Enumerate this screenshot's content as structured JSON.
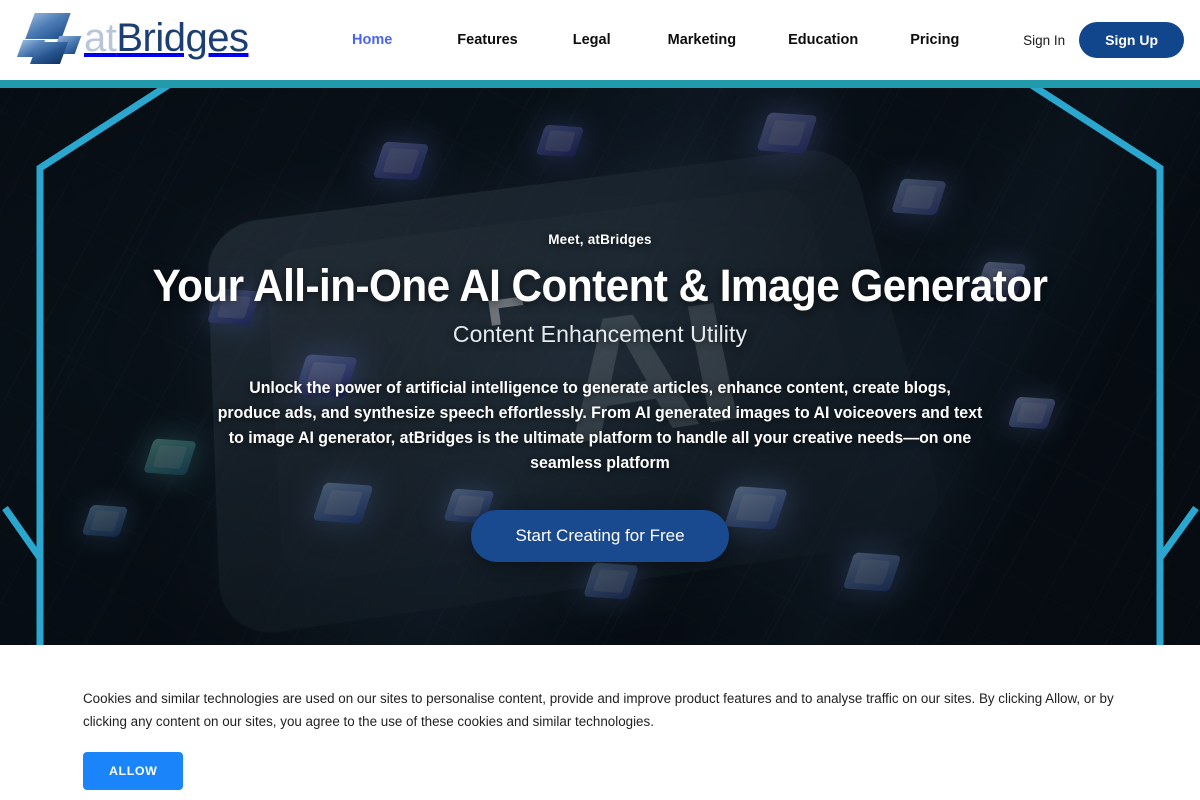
{
  "brand": {
    "logo_prefix": "at",
    "logo_suffix": "Bridges",
    "logo_icon": "parallelogram-blocks-logo"
  },
  "header": {
    "nav": [
      {
        "label": "Home",
        "active": true
      },
      {
        "label": "Features",
        "active": false
      },
      {
        "label": "Legal",
        "active": false
      },
      {
        "label": "Marketing",
        "active": false
      },
      {
        "label": "Education",
        "active": false
      },
      {
        "label": "Pricing",
        "active": false
      }
    ],
    "sign_in_label": "Sign In",
    "sign_up_label": "Sign Up",
    "active_color": "#4b64f4",
    "sign_up_color": "#12468c",
    "accent_bar_color": "#219aab"
  },
  "hero": {
    "eyebrow": "Meet, atBridges",
    "headline": "Your All-in-One AI Content & Image Generator",
    "subhead": "Content Enhancement Utility",
    "blurb": "Unlock the power of artificial intelligence to generate articles, enhance content, create blogs, produce ads, and synthesize speech effortlessly. From AI generated images to AI voiceovers and text to image AI generator, atBridges is the ultimate platform to handle all your creative needs—on one seamless platform",
    "cta_label": "Start Creating for Free",
    "cta_color": "#19498e",
    "frame_color": "#2aa6cf",
    "background_art": "ai-microchip-circuit-board"
  },
  "cookie_banner": {
    "text": "Cookies and similar technologies are used on our sites to personalise content, provide and improve product features and to analyse traffic on our sites. By clicking Allow, or by clicking any content on our sites, you agree to the use of these cookies and similar technologies.",
    "allow_label": "ALLOW",
    "allow_color": "#1a85fa"
  }
}
